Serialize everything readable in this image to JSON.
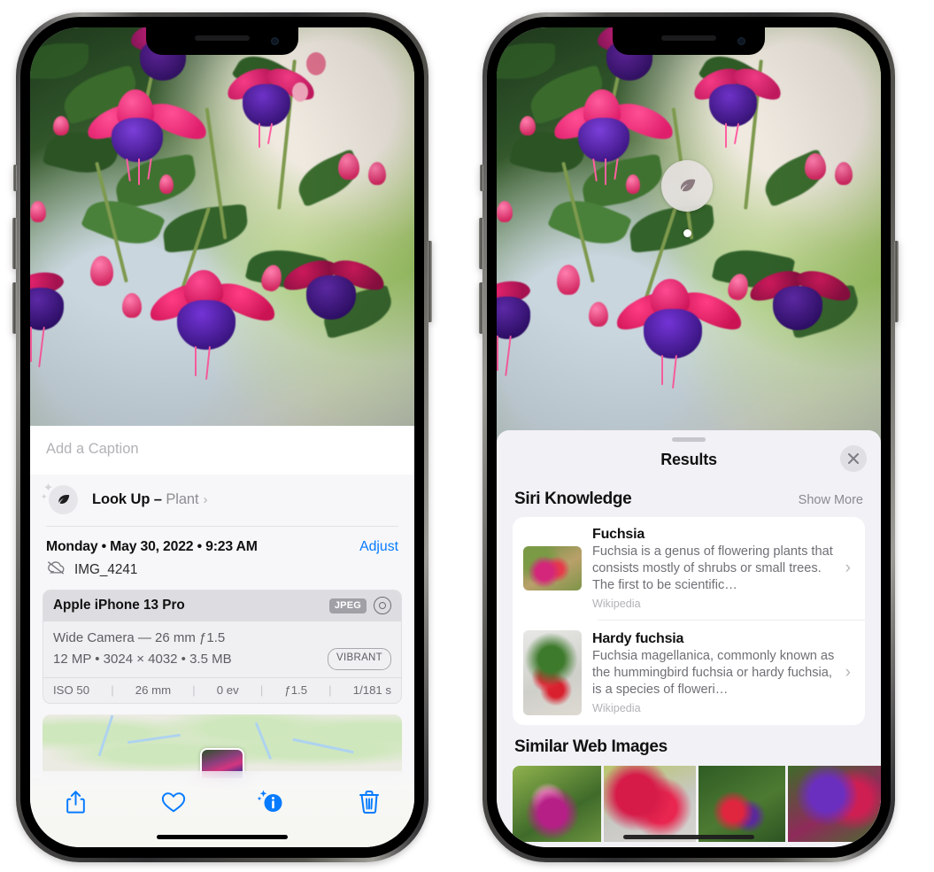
{
  "left_phone": {
    "caption": {
      "placeholder": "Add a Caption",
      "value": ""
    },
    "look_up": {
      "icon": "leaf-icon",
      "label": "Look Up –",
      "subject": "Plant",
      "chevron": "›"
    },
    "metadata": {
      "datetime": "Monday • May 30, 2022 • 9:23 AM",
      "adjust_label": "Adjust",
      "cloud_icon": "icloud-slash-icon",
      "filename": "IMG_4241"
    },
    "camera_card": {
      "model": "Apple iPhone 13 Pro",
      "format_badge": "JPEG",
      "lens_icon": "camera-lens-icon",
      "lens_line": "Wide Camera — 26 mm ƒ1.5",
      "specs_line": "12 MP • 3024 × 4032 • 3.5 MB",
      "style_badge": "VIBRANT",
      "exif": [
        "ISO 50",
        "26 mm",
        "0 ev",
        "ƒ1.5",
        "1/181 s"
      ]
    },
    "toolbar": {
      "share_label": "share-icon",
      "favorite_label": "heart-icon",
      "info_label": "info-sparkle-icon",
      "delete_label": "trash-icon"
    },
    "accent_color": "#067bff"
  },
  "right_phone": {
    "badge": {
      "icon": "leaf-icon"
    },
    "sheet": {
      "title": "Results",
      "close_icon": "close-icon"
    },
    "siri_knowledge": {
      "heading": "Siri Knowledge",
      "show_more": "Show More",
      "items": [
        {
          "title": "Fuchsia",
          "description": "Fuchsia is a genus of flowering plants that consists mostly of shrubs or small trees. The first to be scientific…",
          "source": "Wikipedia",
          "chevron": "›"
        },
        {
          "title": "Hardy fuchsia",
          "description": "Fuchsia magellanica, commonly known as the hummingbird fuchsia or hardy fuchsia, is a species of floweri…",
          "source": "Wikipedia",
          "chevron": "›"
        }
      ]
    },
    "similar_web_images": {
      "heading": "Similar Web Images",
      "thumbnails": [
        "fuchsia-web-image-1",
        "fuchsia-web-image-2",
        "fuchsia-web-image-3",
        "fuchsia-web-image-4"
      ]
    }
  }
}
